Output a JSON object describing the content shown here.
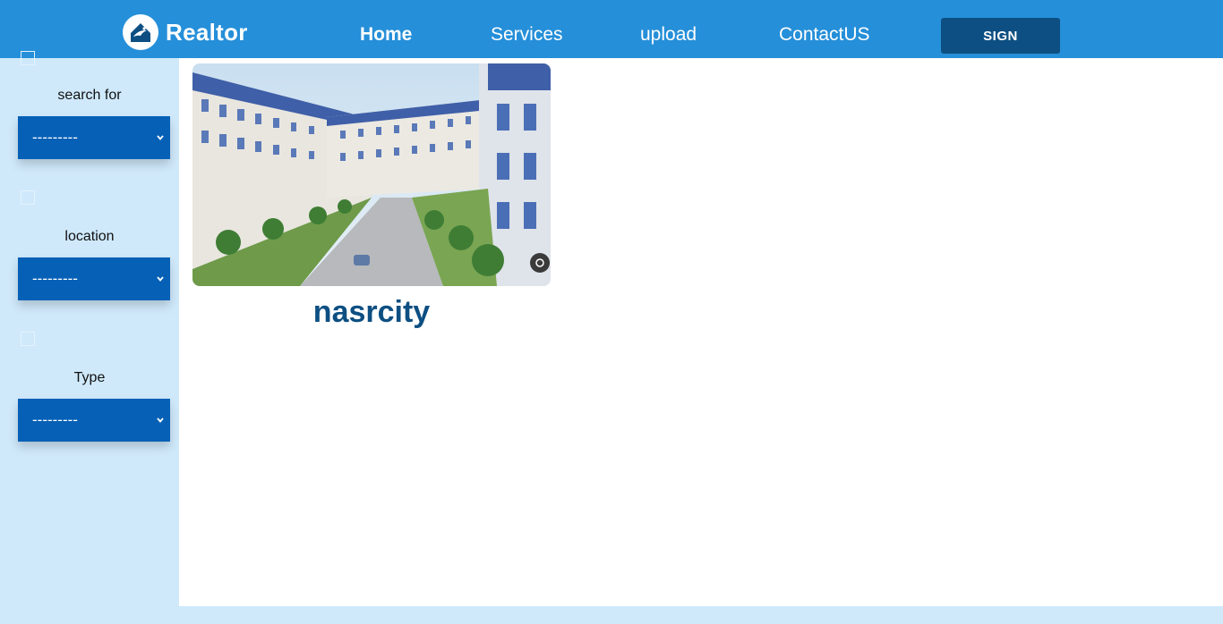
{
  "brand": {
    "name": "Realtor",
    "logo_icon": "house-bird-logo-icon"
  },
  "nav": {
    "home": "Home",
    "services": "Services",
    "upload": "upload",
    "contact": "ContactUS",
    "sign": "SIGN"
  },
  "colors": {
    "navbar": "#258fd9",
    "sign_button": "#0d4f82",
    "sidebar": "#cfe9fb",
    "select": "#0660b6",
    "title": "#0d4f82"
  },
  "filters": [
    {
      "label": "search for",
      "value": "---------"
    },
    {
      "label": "location",
      "value": "---------"
    },
    {
      "label": "Type",
      "value": "---------"
    }
  ],
  "listings": [
    {
      "title": "nasrcity",
      "image": "apartment-complex-photo"
    }
  ]
}
